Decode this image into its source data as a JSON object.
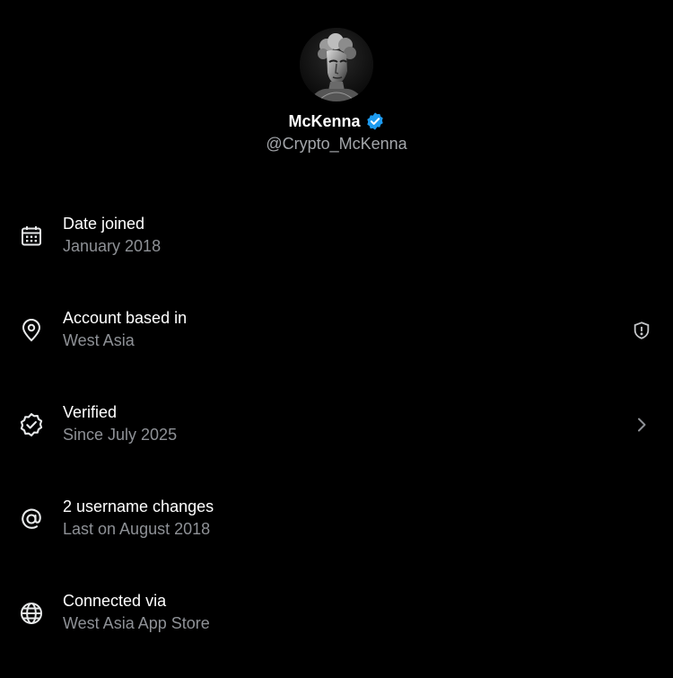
{
  "profile": {
    "display_name": "McKenna",
    "handle": "@Crypto_McKenna",
    "verified_color": "#1d9bf0"
  },
  "info": [
    {
      "title": "Date joined",
      "subtitle": "January 2018",
      "icon": "calendar-icon"
    },
    {
      "title": "Account based in",
      "subtitle": "West Asia",
      "icon": "location-pin-icon",
      "action_icon": "shield-alert-icon"
    },
    {
      "title": "Verified",
      "subtitle": "Since July 2025",
      "icon": "verified-check-icon",
      "action_icon": "chevron-right-icon"
    },
    {
      "title": "2 username changes",
      "subtitle": "Last on August 2018",
      "icon": "at-sign-icon"
    },
    {
      "title": "Connected via",
      "subtitle": "West Asia App Store",
      "icon": "globe-icon"
    }
  ],
  "colors": {
    "background": "#000000",
    "primary_text": "#ffffff",
    "secondary_text": "#8e9196",
    "icon": "#e7e9ea"
  }
}
